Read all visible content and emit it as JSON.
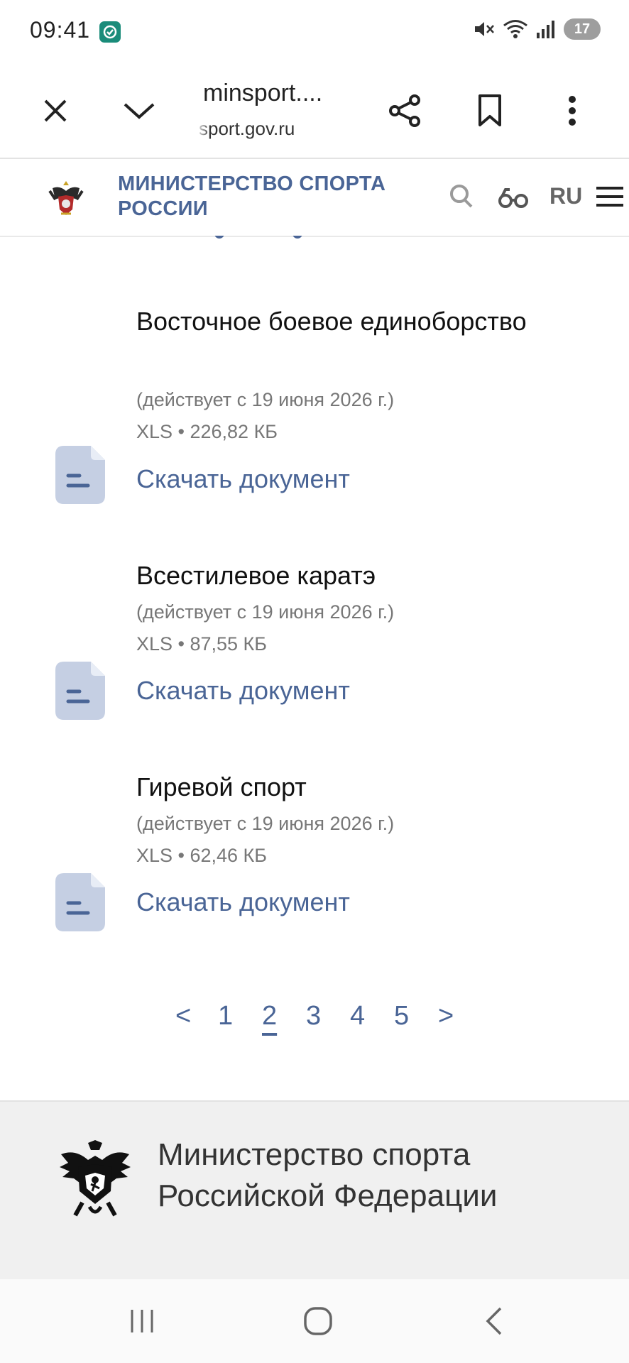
{
  "status_bar": {
    "time": "09:41",
    "battery": "17"
  },
  "browser": {
    "title": "minsport....",
    "domain": "sport.gov.ru"
  },
  "site": {
    "title": "МИНИСТЕРСТВО СПОРТА РОССИИ",
    "language": "RU"
  },
  "documents": [
    {
      "title": "Восточное боевое единоборство",
      "validity": "(действует с 19 июня 2026 г.)",
      "format": "XLS • 226,82 КБ",
      "download_label": "Скачать документ"
    },
    {
      "title": "Всестилевое каратэ",
      "validity": "(действует с 19 июня 2026 г.)",
      "format": "XLS • 87,55 КБ",
      "download_label": "Скачать документ"
    },
    {
      "title": "Гиревой спорт",
      "validity": "(действует с 19 июня 2026 г.)",
      "format": "XLS • 62,46 КБ",
      "download_label": "Скачать документ"
    }
  ],
  "pagination": {
    "prev": "<",
    "pages": [
      "1",
      "2",
      "3",
      "4",
      "5"
    ],
    "current": "2",
    "next": ">"
  },
  "footer": {
    "line1": "Министерство спорта",
    "line2": "Российской Федерации"
  },
  "colors": {
    "accent": "#4a6596",
    "doc_icon": "#c5cfe3",
    "footer_bg": "#f0f0f0"
  }
}
